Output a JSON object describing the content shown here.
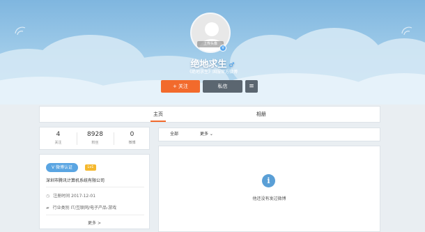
{
  "profile": {
    "avatar_tag": "上传头像",
    "name": "绝地求生",
    "gender_symbol": "♂",
    "subtitle": "《绝地求生》国服官方微博",
    "follow_label": "+ 关注",
    "message_label": "私信",
    "more_label": "≡"
  },
  "tabs": [
    {
      "label": "主页"
    },
    {
      "label": "相册"
    }
  ],
  "stats": [
    {
      "value": "4",
      "label": "关注"
    },
    {
      "value": "8928",
      "label": "粉丝"
    },
    {
      "value": "0",
      "label": "微博"
    }
  ],
  "info": {
    "verify_label": "微博认证",
    "level": "Lv1",
    "company": "深圳市腾讯计算机系统有限公司",
    "register": "注册时间 2017-12-01",
    "industry": "行业类别 IT/互联网/电子产品-游戏",
    "more": "更多 >"
  },
  "feed": {
    "filter_all": "全部",
    "filter_more": "更多 ⌄",
    "empty_text": "他还没有发过微博"
  },
  "icons": {
    "avatar": "user-avatar-placeholder",
    "verified": "verified-v-icon",
    "gender": "male-icon",
    "clock": "clock-icon",
    "briefcase": "briefcase-icon",
    "info": "info-icon",
    "wifi": "wifi-icon"
  },
  "colors": {
    "accent_orange": "#f26a2c",
    "dark_button": "#5b6670",
    "verify_blue": "#5aa5e2",
    "level_yellow": "#f5b82e"
  }
}
